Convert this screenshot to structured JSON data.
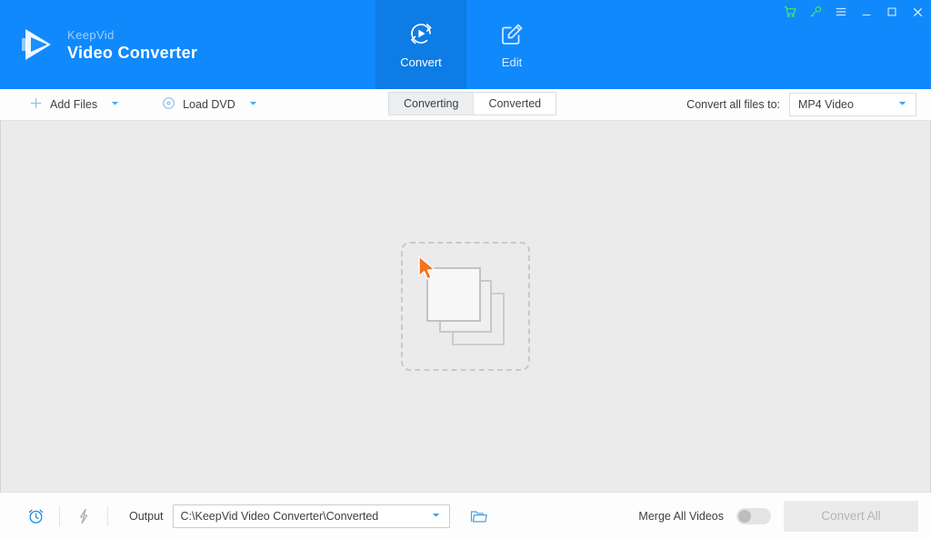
{
  "window": {
    "brand_sub": "KeepVid",
    "brand_main": "Video Converter",
    "controls": [
      {
        "name": "cart-icon",
        "label": "Cart"
      },
      {
        "name": "key-icon",
        "label": "Register"
      },
      {
        "name": "menu-icon",
        "label": "Menu"
      },
      {
        "name": "minimize-icon",
        "label": "Minimize"
      },
      {
        "name": "maximize-icon",
        "label": "Maximize"
      },
      {
        "name": "close-icon",
        "label": "Close"
      }
    ]
  },
  "nav": {
    "tabs": [
      {
        "label": "Convert",
        "icon": "convert-icon",
        "active": true
      },
      {
        "label": "Edit",
        "icon": "edit-icon",
        "active": false
      }
    ]
  },
  "toolbar": {
    "add_files_label": "Add Files",
    "load_dvd_label": "Load DVD",
    "segments": [
      {
        "label": "Converting",
        "active": true
      },
      {
        "label": "Converted",
        "active": false
      }
    ],
    "convert_all_to_label": "Convert all files to:",
    "format_value": "MP4 Video"
  },
  "main": {
    "dropzone_hint": ""
  },
  "bottom": {
    "schedule_icon": "alarm-clock-icon",
    "speed_icon": "lightning-bolt-icon",
    "output_label": "Output",
    "output_path": "C:\\KeepVid Video Converter\\Converted",
    "browse_icon": "open-folder-icon",
    "merge_label": "Merge All Videos",
    "merge_enabled": false,
    "convert_all_label": "Convert All",
    "convert_all_enabled": false
  },
  "colors": {
    "header_blue": "#1089fd",
    "active_tab_blue": "#0d7ce4",
    "accent_blue": "#2196f3",
    "icon_blue": "#7fb9e8",
    "canvas_gray": "#ebebeb",
    "cursor_orange": "#f4731c"
  }
}
